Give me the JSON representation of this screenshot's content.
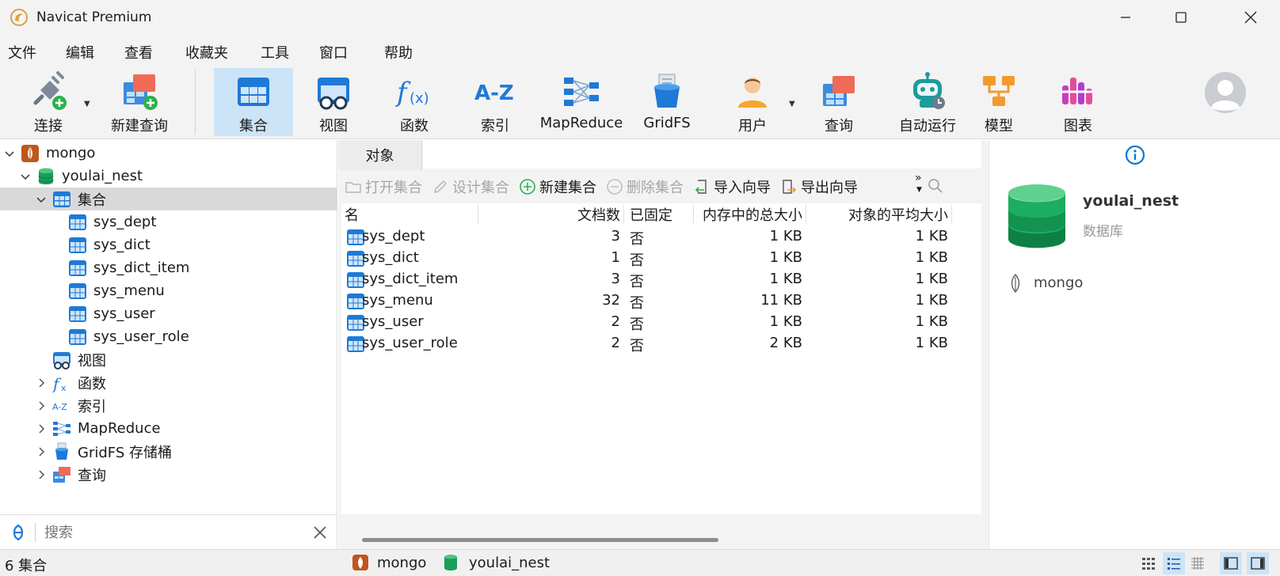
{
  "window": {
    "title": "Navicat Premium"
  },
  "menu": {
    "items": [
      "文件",
      "编辑",
      "查看",
      "收藏夹",
      "工具",
      "窗口",
      "帮助"
    ]
  },
  "toolbar": {
    "items": [
      {
        "label": "连接",
        "icon": "connection-icon"
      },
      {
        "label": "新建查询",
        "icon": "new-query-icon"
      },
      {
        "label": "集合",
        "icon": "collection-icon",
        "active": true
      },
      {
        "label": "视图",
        "icon": "view-icon"
      },
      {
        "label": "函数",
        "icon": "function-icon"
      },
      {
        "label": "索引",
        "icon": "index-icon"
      },
      {
        "label": "MapReduce",
        "icon": "mapreduce-icon"
      },
      {
        "label": "GridFS",
        "icon": "gridfs-icon"
      },
      {
        "label": "用户",
        "icon": "user-icon"
      },
      {
        "label": "查询",
        "icon": "query-icon"
      },
      {
        "label": "自动运行",
        "icon": "automation-icon"
      },
      {
        "label": "模型",
        "icon": "model-icon"
      },
      {
        "label": "图表",
        "icon": "chart-icon"
      }
    ]
  },
  "tree": {
    "connection": "mongo",
    "database": "youlai_nest",
    "collections_label": "集合",
    "collections": [
      "sys_dept",
      "sys_dict",
      "sys_dict_item",
      "sys_menu",
      "sys_user",
      "sys_user_role"
    ],
    "views_label": "视图",
    "functions_label": "函数",
    "indexes_label": "索引",
    "mapreduce_label": "MapReduce",
    "gridfs_label": "GridFS 存储桶",
    "queries_label": "查询"
  },
  "search": {
    "placeholder": "搜索"
  },
  "center": {
    "tab": "对象",
    "actions": {
      "open": "打开集合",
      "design": "设计集合",
      "new": "新建集合",
      "delete": "删除集合",
      "import": "导入向导",
      "export": "导出向导"
    },
    "columns": [
      "名",
      "文档数",
      "已固定",
      "内存中的总大小",
      "对象的平均大小"
    ],
    "rows": [
      {
        "name": "sys_dept",
        "docs": "3",
        "capped": "否",
        "size": "1 KB",
        "avg": "1 KB"
      },
      {
        "name": "sys_dict",
        "docs": "1",
        "capped": "否",
        "size": "1 KB",
        "avg": "1 KB"
      },
      {
        "name": "sys_dict_item",
        "docs": "3",
        "capped": "否",
        "size": "1 KB",
        "avg": "1 KB"
      },
      {
        "name": "sys_menu",
        "docs": "32",
        "capped": "否",
        "size": "11 KB",
        "avg": "1 KB"
      },
      {
        "name": "sys_user",
        "docs": "2",
        "capped": "否",
        "size": "1 KB",
        "avg": "1 KB"
      },
      {
        "name": "sys_user_role",
        "docs": "2",
        "capped": "否",
        "size": "2 KB",
        "avg": "1 KB"
      }
    ]
  },
  "info": {
    "db_name": "youlai_nest",
    "db_type": "数据库",
    "connection": "mongo"
  },
  "status": {
    "count": "6 集合",
    "connection": "mongo",
    "database": "youlai_nest"
  },
  "colors": {
    "accent": "#0078d4",
    "selected_bg": "#cce4f7",
    "db_green": "#1a9e5a",
    "mongo_orange": "#c0561b"
  }
}
